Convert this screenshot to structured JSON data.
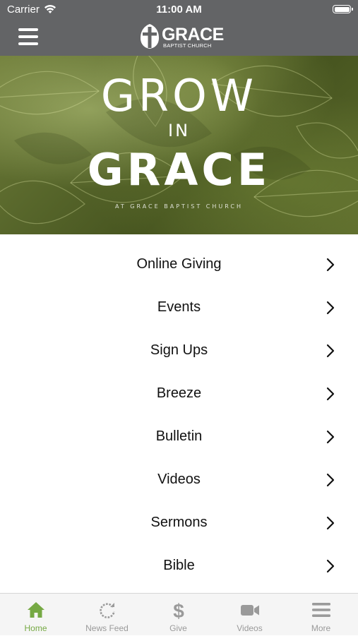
{
  "status_bar": {
    "carrier": "Carrier",
    "time": "11:00 AM",
    "wifi_icon": "wifi-icon",
    "battery_icon": "battery-icon"
  },
  "nav_bar": {
    "menu_icon": "hamburger-menu-icon",
    "logo": {
      "word": "GRACE",
      "sub": "BAPTIST CHURCH"
    }
  },
  "banner": {
    "line1": "GROW",
    "line2": "IN",
    "line3": "GRACE",
    "tagline": "AT GRACE BAPTIST CHURCH"
  },
  "menu": {
    "items": [
      {
        "label": "Online Giving"
      },
      {
        "label": "Events"
      },
      {
        "label": "Sign Ups"
      },
      {
        "label": "Breeze"
      },
      {
        "label": "Bulletin"
      },
      {
        "label": "Videos"
      },
      {
        "label": "Sermons"
      },
      {
        "label": "Bible"
      }
    ],
    "chevron_icon": "chevron-right-icon"
  },
  "tab_bar": {
    "active_color": "#76a944",
    "inactive_color": "#9a9a9a",
    "tabs": [
      {
        "label": "Home",
        "icon": "home-icon",
        "active": true
      },
      {
        "label": "News Feed",
        "icon": "refresh-icon",
        "active": false
      },
      {
        "label": "Give",
        "icon": "dollar-icon",
        "active": false
      },
      {
        "label": "Videos",
        "icon": "video-camera-icon",
        "active": false
      },
      {
        "label": "More",
        "icon": "more-menu-icon",
        "active": false
      }
    ]
  },
  "colors": {
    "header_bg": "#636466",
    "accent": "#76a944"
  }
}
